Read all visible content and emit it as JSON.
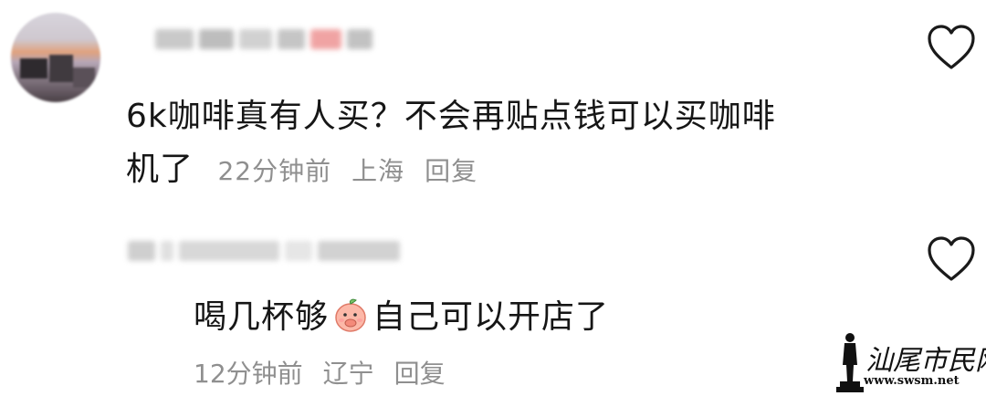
{
  "comments": [
    {
      "text_line1": "6k咖啡真有人买？不会再贴点钱可以买咖啡",
      "text_line2": "机了",
      "time": "22分钟前",
      "location": "上海",
      "reply_label": "回复"
    },
    {
      "text_before_emoji": "喝几杯够",
      "emoji": "peach-covering-mouth-emoji",
      "text_after_emoji": "自己可以开店了",
      "time": "12分钟前",
      "location": "辽宁",
      "reply_label": "回复"
    }
  ],
  "icons": {
    "like": "heart-outline-icon"
  },
  "watermark": {
    "title": "汕尾市民网",
    "url": "www.swsm.net"
  }
}
